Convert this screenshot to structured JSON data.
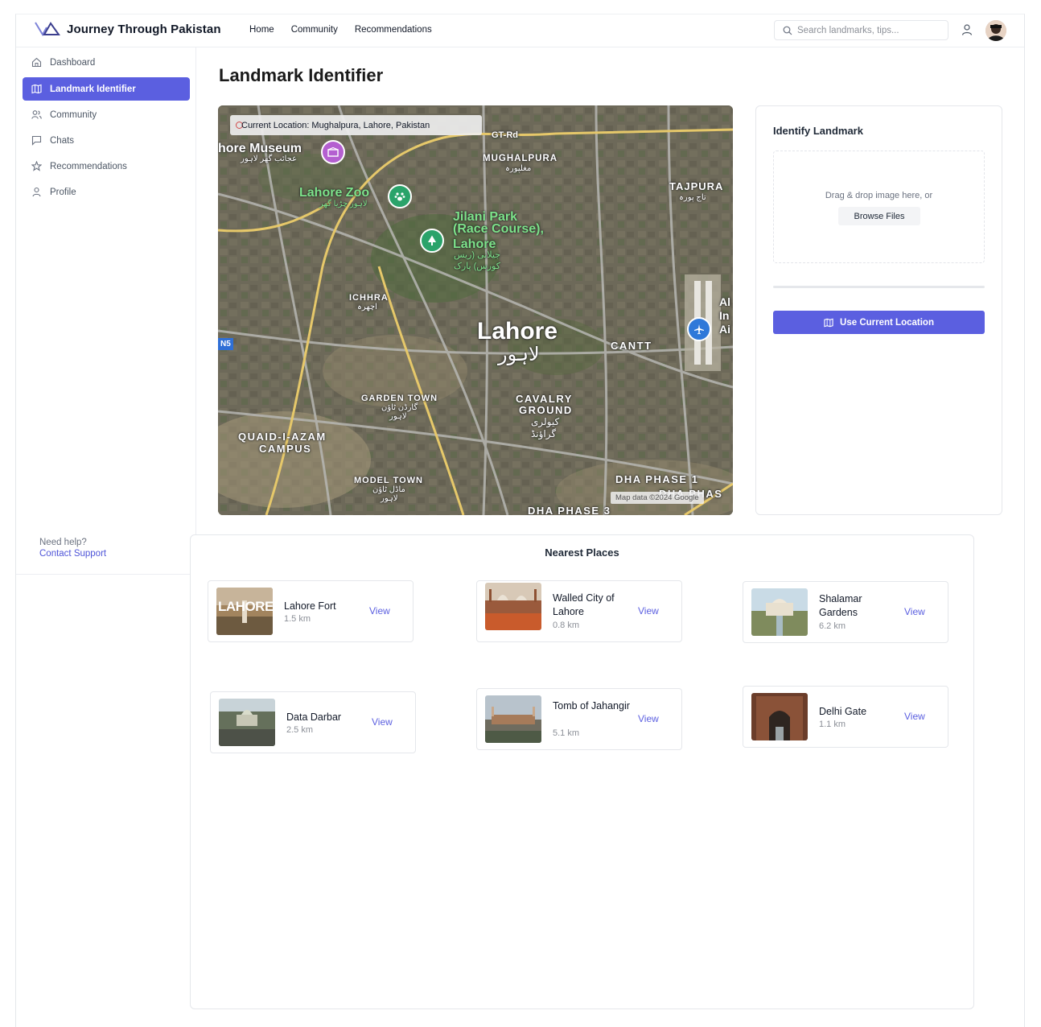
{
  "app": {
    "title": "Journey Through Pakistan",
    "accent": "#5b5fe0"
  },
  "nav": {
    "links": [
      "Home",
      "Community",
      "Recommendations"
    ],
    "search_placeholder": "Search landmarks, tips..."
  },
  "sidebar": {
    "items": [
      {
        "label": "Dashboard",
        "icon": "home-icon",
        "active": false
      },
      {
        "label": "Landmark Identifier",
        "icon": "map-icon",
        "active": true
      },
      {
        "label": "Community",
        "icon": "users-icon",
        "active": false
      },
      {
        "label": "Chats",
        "icon": "chat-icon",
        "active": false
      },
      {
        "label": "Recommendations",
        "icon": "star-icon",
        "active": false
      },
      {
        "label": "Profile",
        "icon": "user-icon",
        "active": false
      }
    ],
    "help_label": "Need help?",
    "help_link": "Contact Support"
  },
  "main": {
    "title": "Landmark Identifier"
  },
  "map": {
    "current_location": "Current Location: Mughalpura, Lahore, Pakistan",
    "credit": "Map data ©2024 Google",
    "highway": "N5",
    "labels": {
      "museum": "hore Museum",
      "museum_ur": "عجائب گھر لاہور",
      "zoo": "Lahore Zoo",
      "zoo_ur": "لاہور چڑیا گھر",
      "park_1": "Jilani Park",
      "park_2": "(Race Course),",
      "park_3": "Lahore",
      "park_ur_1": "جیلانی (ریس",
      "park_ur_2": "کورس) پارک",
      "gt_rd": "GT-Rd",
      "mughalpura": "MUGHALPURA",
      "mughalpura_ur": "مغلپورہ",
      "tajpura": "TAJPURA",
      "tajpura_ur": "تاج پورہ",
      "ichhra": "ICHHRA",
      "ichhra_ur": "اچھرہ",
      "city": "Lahore",
      "city_ur": "لاہور",
      "cantt": "CANTT",
      "garden_town": "GARDEN TOWN",
      "garden_town_ur_1": "گارڈن ٹاؤن",
      "garden_town_ur_2": "لاہور",
      "cavalry_1": "CAVALRY",
      "cavalry_2": "GROUND",
      "cavalry_ur_1": "کیولری",
      "cavalry_ur_2": "گراؤنڈ",
      "qa_campus_1": "QUAID-I-AZAM",
      "qa_campus_2": "CAMPUS",
      "model_town": "MODEL TOWN",
      "model_town_ur_1": "ماڈل ٹاؤن",
      "model_town_ur_2": "لاہور",
      "dha1": "DHA PHASE 1",
      "dha_partial": "DHA PHAS",
      "dha3": "DHA PHASE 3",
      "airport_1": "Al",
      "airport_2": "In",
      "airport_3": "Ai"
    }
  },
  "identify": {
    "title": "Identify Landmark",
    "drop_text": "Drag & drop image here, or",
    "browse_label": "Browse Files",
    "progress": 0,
    "use_location_label": "Use Current Location"
  },
  "nearest": {
    "title": "Nearest Places",
    "view_label": "View",
    "places": [
      {
        "name": "Lahore Fort",
        "distance": "1.5 km",
        "thumb_text": "LAHORE"
      },
      {
        "name": "Walled City of Lahore",
        "distance": "0.8 km"
      },
      {
        "name": "Shalamar Gardens",
        "distance": "6.2 km"
      },
      {
        "name": "Data Darbar",
        "distance": "2.5 km"
      },
      {
        "name": "Tomb of Jahangir",
        "distance": "5.1 km"
      },
      {
        "name": "Delhi Gate",
        "distance": "1.1 km"
      }
    ]
  }
}
